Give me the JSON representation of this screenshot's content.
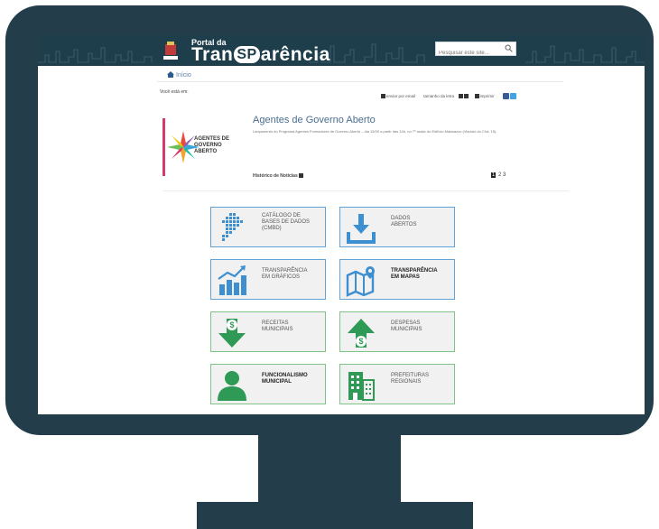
{
  "site": {
    "brand_top": "Portal da",
    "brand_pre": "Tran",
    "brand_sp": "SP",
    "brand_post": "arência",
    "search_placeholder": "Pesquisar este site..."
  },
  "breadcrumb": {
    "home": "Início",
    "you_are_here": "Você está em:"
  },
  "tools": {
    "email": "enviar por email",
    "font_size": "tamanho da letra",
    "print": "imprimir"
  },
  "news": {
    "logo_text": [
      "AGENTES DE",
      "GOVERNO",
      "ABERTO"
    ],
    "title": "Agentes de Governo Aberto",
    "description": "Lançamento do Programa Agentes Formadores de Governo Aberto – dia 15/09 a partir das 14h, no 7º andar do Edifício Matarazzo (Viaduto do Chá, 15).",
    "history_link": "Histórico de Notícias",
    "pages": [
      "1",
      "2",
      "3"
    ]
  },
  "tiles": [
    {
      "line1": "CATÁLOGO DE",
      "line2": "BASES DE DADOS",
      "line3": "(CMBD)",
      "icon": "map-dots-icon"
    },
    {
      "line1": "DADOS",
      "line2": "ABERTOS",
      "line3": "",
      "icon": "download-icon"
    },
    {
      "line1": "TRANSPARÊNCIA",
      "line2": "EM GRÁFICOS",
      "line3": "",
      "icon": "bar-chart-icon"
    },
    {
      "line1": "TRANSPARÊNCIA",
      "line2": "EM MAPAS",
      "line3": "",
      "icon": "folded-map-icon"
    },
    {
      "line1": "RECEITAS",
      "line2": "MUNICIPAIS",
      "line3": "",
      "icon": "revenue-icon"
    },
    {
      "line1": "DESPESAS",
      "line2": "MUNICIPAIS",
      "line3": "",
      "icon": "expense-icon"
    },
    {
      "line1": "FUNCIONALISMO",
      "line2": "MUNICIPAL",
      "line3": "",
      "icon": "person-icon"
    },
    {
      "line1": "PREFEITURAS",
      "line2": "REGIONAIS",
      "line3": "",
      "icon": "building-icon"
    }
  ],
  "colors": {
    "frame": "#233d4a",
    "header": "#1f3e4b",
    "tile_blue": "#5fa3d8",
    "tile_green": "#7fc486",
    "icon_blue": "#3e8fd0",
    "icon_green": "#2e9a55"
  }
}
